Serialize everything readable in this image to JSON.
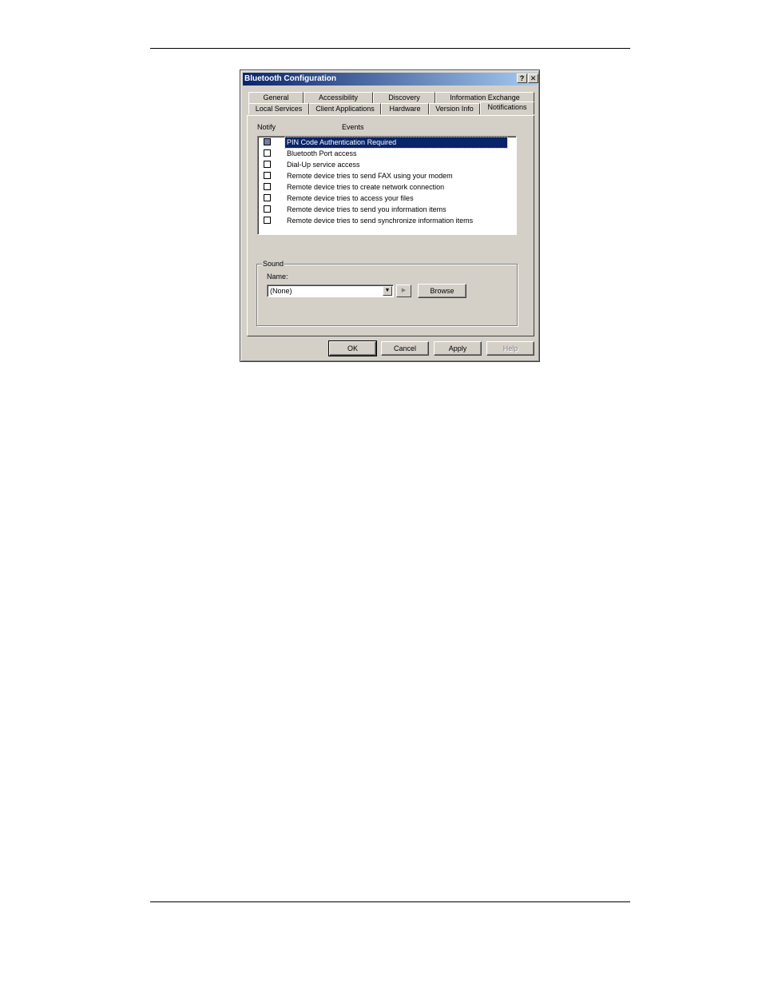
{
  "window": {
    "title": "Bluetooth Configuration",
    "help_glyph": "?",
    "close_glyph": "✕"
  },
  "tabs": {
    "row1": [
      "General",
      "Accessibility",
      "Discovery",
      "Information Exchange"
    ],
    "row2": [
      "Local Services",
      "Client Applications",
      "Hardware",
      "Version Info",
      "Notifications"
    ],
    "active": "Notifications"
  },
  "notifications": {
    "notify_header": "Notify",
    "events_header": "Events",
    "events": [
      {
        "label": "PIN Code Authentication Required",
        "checked": false,
        "selected": true
      },
      {
        "label": "Bluetooth Port access",
        "checked": false,
        "selected": false
      },
      {
        "label": "Dial-Up service access",
        "checked": false,
        "selected": false
      },
      {
        "label": "Remote device tries to send FAX using your modem",
        "checked": false,
        "selected": false
      },
      {
        "label": "Remote device tries to create network connection",
        "checked": false,
        "selected": false
      },
      {
        "label": "Remote device tries to access your files",
        "checked": false,
        "selected": false
      },
      {
        "label": "Remote device tries to send you information items",
        "checked": false,
        "selected": false
      },
      {
        "label": "Remote device tries to send synchronize information items",
        "checked": false,
        "selected": false
      }
    ]
  },
  "sound": {
    "group_title": "Sound",
    "name_label": "Name:",
    "selected": "(None)",
    "browse_label": "Browse"
  },
  "buttons": {
    "ok": "OK",
    "cancel": "Cancel",
    "apply": "Apply",
    "help": "Help"
  }
}
